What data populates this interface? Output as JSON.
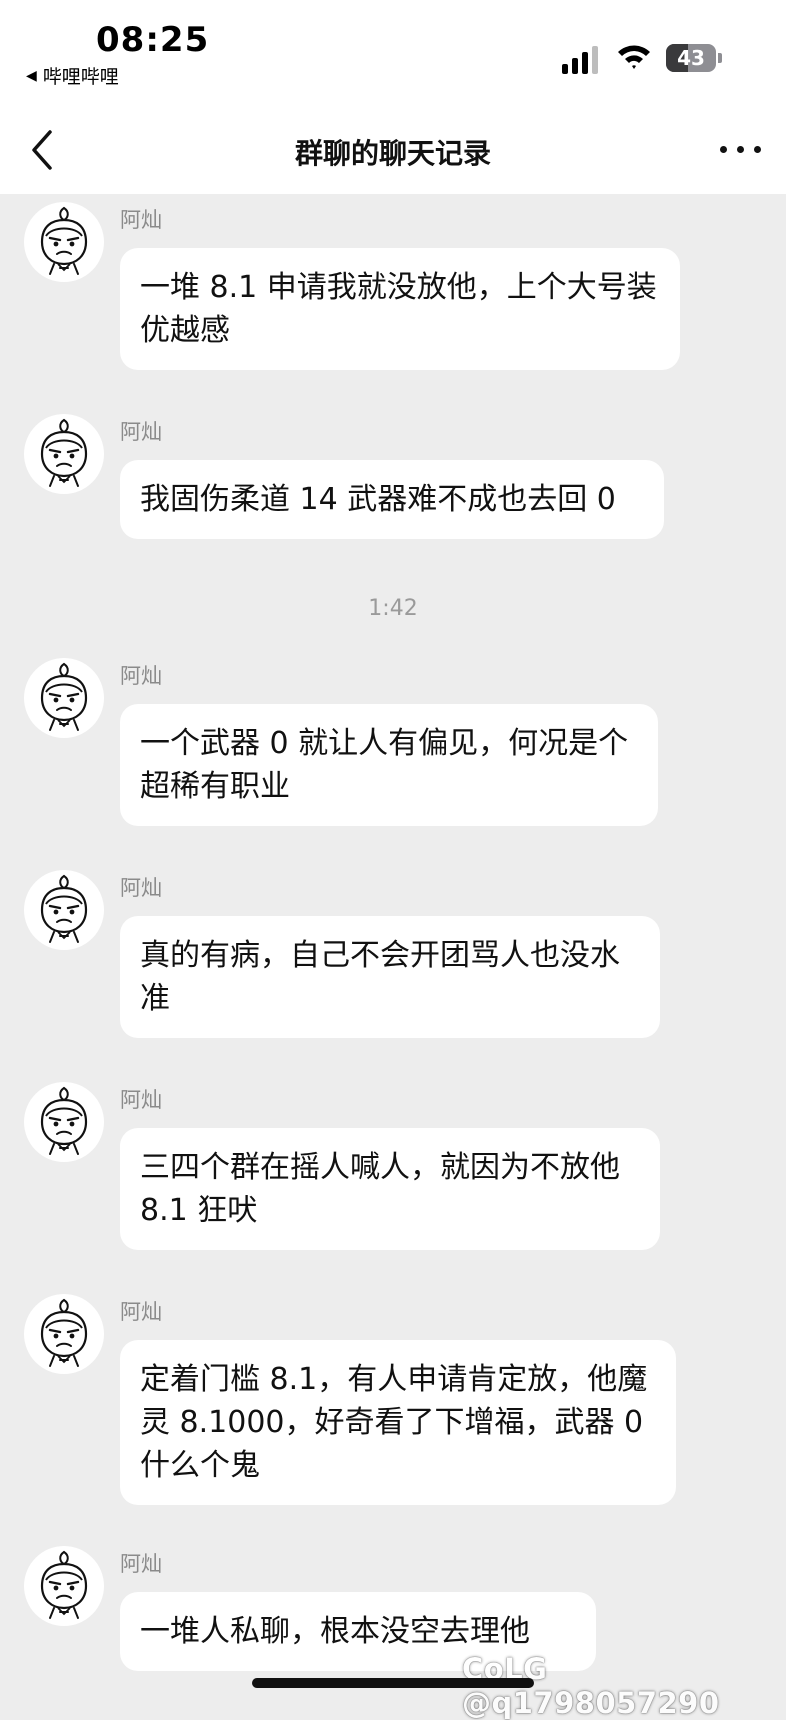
{
  "status_bar": {
    "time": "08:25",
    "back_app": "哔哩哔哩",
    "battery": "43"
  },
  "nav": {
    "title": "群聊的聊天记录"
  },
  "messages": [
    {
      "sender": "阿灿",
      "text": "一堆 8.1 申请我就没放他，上个大号装优越感"
    },
    {
      "sender": "阿灿",
      "text": "我固伤柔道 14 武器难不成也去回 0"
    },
    {
      "sender": "阿灿",
      "text": "一个武器 0 就让人有偏见，何况是个超稀有职业"
    },
    {
      "sender": "阿灿",
      "text": "真的有病，自己不会开团骂人也没水准"
    },
    {
      "sender": "阿灿",
      "text": "三四个群在摇人喊人，就因为不放他 8.1 狂吠"
    },
    {
      "sender": "阿灿",
      "text": "定着门槛 8.1，有人申请肯定放，他魔灵 8.1000，好奇看了下增福，武器 0 什么个鬼"
    },
    {
      "sender": "阿灿",
      "text": "一堆人私聊，根本没空去理他"
    }
  ],
  "timestamp": "1:42",
  "watermark": "CoLG @q1798057290"
}
